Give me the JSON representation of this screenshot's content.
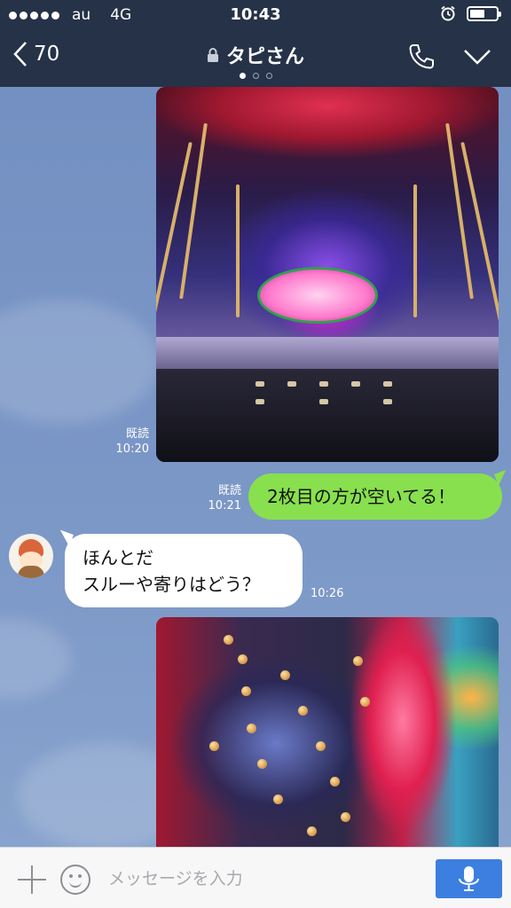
{
  "status_bar": {
    "carrier": "au",
    "network": "4G",
    "time": "10:43",
    "signal_bars": 5,
    "icons": [
      "alarm-icon",
      "battery-icon"
    ]
  },
  "header": {
    "back_count": "70",
    "title": "タピさん",
    "page_index": 0,
    "page_count": 3,
    "icons": [
      "back-chevron-icon",
      "lock-icon",
      "phone-icon",
      "chevron-down-icon"
    ]
  },
  "messages": [
    {
      "type": "image",
      "side": "right",
      "read_label": "既読",
      "time": "10:20",
      "alt_icon": "pachinko-machine-photo"
    },
    {
      "type": "text",
      "side": "right",
      "read_label": "既読",
      "time": "10:21",
      "text": "2枚目の方が空いてる！"
    },
    {
      "type": "text",
      "side": "left",
      "lines": [
        "ほんとだ",
        "スルーや寄りはどう？"
      ],
      "time": "10:26",
      "avatar": "avatar"
    },
    {
      "type": "image",
      "side": "right",
      "alt_icon": "pachinko-machine-photo"
    }
  ],
  "input_bar": {
    "placeholder": "メッセージを入力",
    "icons": [
      "plus-icon",
      "emoji-icon",
      "mic-icon"
    ]
  },
  "colors": {
    "header_bg": "#253247",
    "chat_bg": "#7896c4",
    "outgoing_bubble": "#88e04e",
    "incoming_bubble": "#ffffff",
    "mic_button": "#3c7fe0"
  }
}
